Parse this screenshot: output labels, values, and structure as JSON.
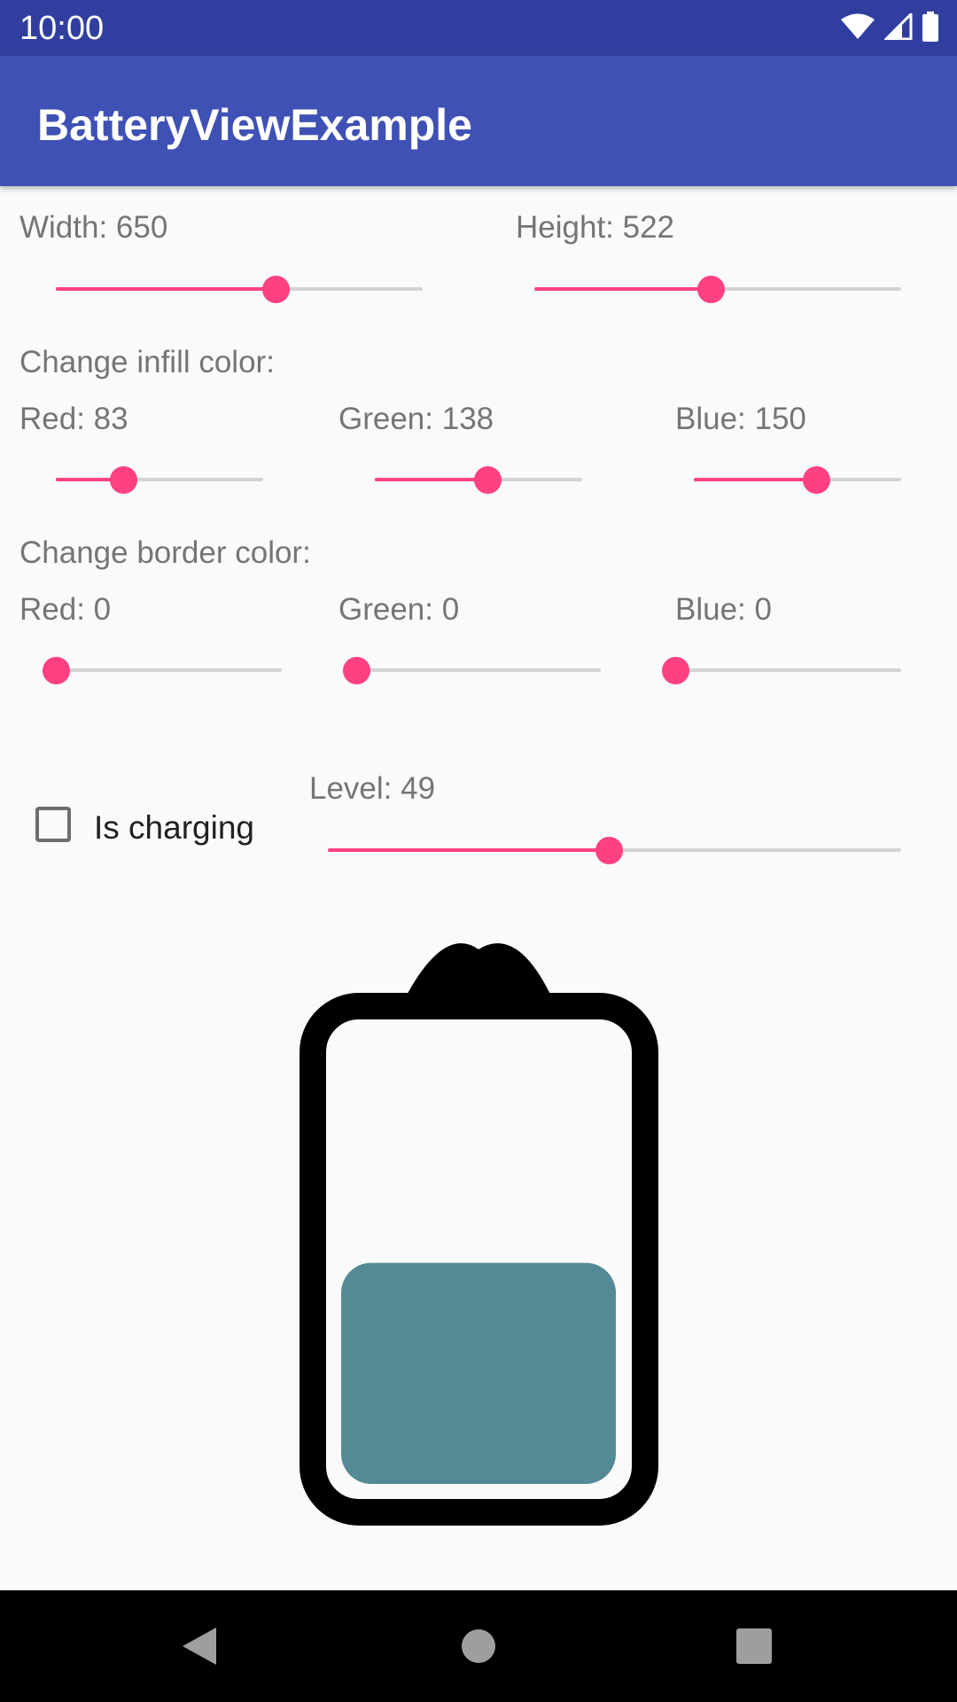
{
  "status_bar": {
    "time": "10:00",
    "icons": [
      "wifi-icon",
      "cell-signal-icon",
      "battery-icon"
    ]
  },
  "app_bar": {
    "title": "BatteryViewExample"
  },
  "size_controls": {
    "width_label": "Width: 650",
    "height_label": "Height: 522",
    "width_value": 650,
    "height_value": 522,
    "width_level": 0.6,
    "height_level": 0.48
  },
  "infill_color": {
    "heading": "Change infill color:",
    "red_label": "Red: 83",
    "green_label": "Green: 138",
    "blue_label": "Blue: 150",
    "red": 83,
    "green": 138,
    "blue": 150
  },
  "border_color": {
    "heading": "Change border color:",
    "red_label": "Red: 0",
    "green_label": "Green: 0",
    "blue_label": "Blue: 0",
    "red": 0,
    "green": 0,
    "blue": 0
  },
  "charging": {
    "label": "Is charging",
    "checked": false
  },
  "level": {
    "label": "Level: 49",
    "value": 49
  },
  "colors": {
    "status_bar": "#303f9f",
    "app_bar": "#3f51b5",
    "accent": "#ff4081",
    "infill": "#538a96",
    "border": "#000000"
  },
  "nav_bar": {
    "icons": [
      "back-icon",
      "home-icon",
      "recents-icon"
    ]
  }
}
